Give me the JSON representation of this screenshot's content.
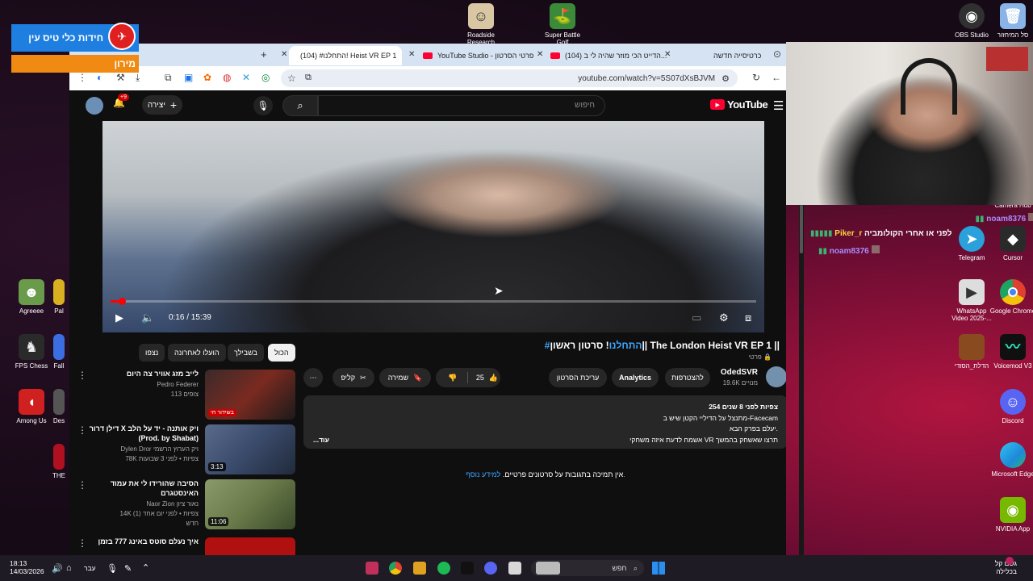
{
  "overlay": {
    "banner_title": "חידות כלי טיס עין",
    "banner_subtitle": "מירון"
  },
  "desktop_icons_top": [
    {
      "label": "Roadside Research",
      "color": "#d8c7a2"
    },
    {
      "label": "Super Battle Golf",
      "color": "#3a8a3a"
    },
    {
      "label": "OBS Studio",
      "color": "#303030"
    },
    {
      "label": "סל המיחזור",
      "color": "#8ab4e8"
    }
  ],
  "desktop_icons_left": [
    {
      "label": "Agreeee",
      "color": "#6a9b4a"
    },
    {
      "label": "Pal",
      "color": "#d8b020"
    },
    {
      "label": "FPS Chess",
      "color": "#e0e0e0"
    },
    {
      "label": "Fall",
      "color": "#3b6ee0"
    },
    {
      "label": "Among Us",
      "color": "#d02020"
    },
    {
      "label": "Des",
      "color": "#555555"
    },
    {
      "label": "THE",
      "color": "#b01020"
    }
  ],
  "desktop_icons_right": [
    {
      "label": "Camera Hub",
      "color": "#1f2a3a"
    },
    {
      "label": "Telegram",
      "color": "#2aa1da"
    },
    {
      "label": "Cursor",
      "color": "#2a2a2a"
    },
    {
      "label": "WhatsApp Video 2025-...",
      "color": "#ddd"
    },
    {
      "label": "Google Chrome",
      "color": "#e04030"
    },
    {
      "label": "הדלת_הסודי",
      "color": "#8a4a20"
    },
    {
      "label": "Voicemod V3",
      "color": "#101010"
    },
    {
      "label": "Discord",
      "color": "#5865f2"
    },
    {
      "label": "Microsoft Edge",
      "color": "#1c8ad8"
    },
    {
      "label": "NVIDIA App",
      "color": "#76b900"
    }
  ],
  "browser": {
    "tabs": [
      {
        "label": "כרטיסייה חדשה"
      },
      {
        "label": "(104) הדייט הכי מוזר שהיה לי ב..."
      },
      {
        "label": "YouTube Studio - פרטי הסרטון"
      },
      {
        "label": "(104) #התחלנו! Heist VR EP 1"
      }
    ],
    "url": "youtube.com/watch?v=5S07dXsBJVM"
  },
  "youtube": {
    "notifications": "+9",
    "create_label": "יצירה",
    "search_placeholder": "חיפוש",
    "logo_text": "YouTube",
    "player": {
      "current_time": "0:16",
      "duration": "15:39",
      "time_display": "0:16 / 15:39",
      "progress_fraction": 0.017
    },
    "video": {
      "title_tag": "#התחלנו",
      "title_rest": "! סרטון ראשון|| The London Heist VR EP 1 ||",
      "privacy": "פרטי",
      "channel": "OdedSVR",
      "subscribers": "19.6K מנויים",
      "like_count": "25",
      "buttons": {
        "subscribers_btn": "להצטרפות",
        "analytics": "Analytics",
        "edit": "עריכת הסרטון",
        "save": "שמירה",
        "clip": "קליפ"
      },
      "description": {
        "stats": "254 צפיות  לפני 8 שנים",
        "line1": "מתנצל על הדיליי הקטן שיש ב-Facecam",
        "line2": "יעלם בפרק הבא.",
        "line3": "אשמח לדעת איזה משחקי VR תרצו שאשחק בהמשך",
        "more": "...עוד"
      },
      "comments_off": "אין תמיכה בתגובות על סרטונים פרטיים.",
      "learn_more": "למידע נוסף."
    },
    "filters": [
      "הכול",
      "בשבילך",
      "הועלו לאחרונה",
      "נצפו"
    ],
    "recommendations": [
      {
        "title": "לייב מזג אוויר צה היום",
        "channel": "Pedro Federer",
        "meta": "113 צופים",
        "badge": "בשידור חי",
        "thumb_color": "#7a2a20"
      },
      {
        "title": "דילן דרור X ויק אותנה - יד על הלב (Prod. by Shabat)",
        "channel": "Dylen Dror ויק הערוץ הרשמי",
        "meta": "78K צפיות • לפני 3 שבועות",
        "duration": "3:13",
        "thumb_color": "#3a4a6a"
      },
      {
        "title": "הסיבה שהורידו לי את עמוד האינסטגרם",
        "channel": "Naor Zion נאור ציון",
        "meta": "14K צפיות • לפני יום אחד (1)",
        "extra": "חדש",
        "duration": "11:06",
        "thumb_color": "#6a7a4a"
      },
      {
        "title": "איך נעלם סוטס באינג 777 בזמן",
        "thumb_color": "#b01010"
      }
    ]
  },
  "chat": [
    {
      "user": "noam8376",
      "color": "#a98cff"
    },
    {
      "user": "Piker_r",
      "message": "לפני או אחרי הקולומביה",
      "color": "#ffd23f"
    },
    {
      "user": "noam8376",
      "color": "#a98cff"
    }
  ],
  "taskbar": {
    "time": "18:13",
    "date": "14/03/2026",
    "lang": "עבר",
    "search_label": "חפש",
    "weather": "גשם קל",
    "weather_sub": "בכלילה"
  }
}
